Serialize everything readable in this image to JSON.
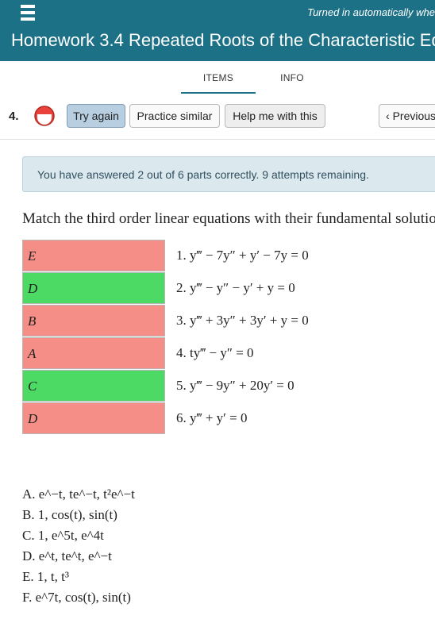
{
  "header": {
    "autosave_text": "Turned in automatically whe",
    "title": "Homework 3.4 Repeated Roots of the Characteristic Eq",
    "brand_color": "#1d7186"
  },
  "tabs": [
    {
      "label": "ITEMS",
      "active": true
    },
    {
      "label": "INFO",
      "active": false
    }
  ],
  "question": {
    "number": "4.",
    "status_icon": "partial-credit-icon",
    "buttons": {
      "try_again": "Try again",
      "practice_similar": "Practice similar",
      "help": "Help me with this",
      "previous": "Previous"
    }
  },
  "alert": {
    "text": "You have answered 2 out of 6 parts correctly. 9 attempts remaining."
  },
  "prompt": "Match the third order linear equations with their fundamental solution",
  "answers": [
    {
      "value": "E",
      "status": "wrong"
    },
    {
      "value": "D",
      "status": "correct"
    },
    {
      "value": "B",
      "status": "wrong"
    },
    {
      "value": "A",
      "status": "wrong"
    },
    {
      "value": "C",
      "status": "correct"
    },
    {
      "value": "D",
      "status": "wrong"
    }
  ],
  "colors": {
    "wrong": "#f48e86",
    "correct": "#4cd964"
  },
  "equations": [
    "1. y‴ − 7y″ + y′ − 7y = 0",
    "2. y‴ − y″ − y′ + y = 0",
    "3. y‴ + 3y″ + 3y′ + y = 0",
    "4. ty‴ − y″ = 0",
    "5. y‴ − 9y″ + 20y′ = 0",
    "6. y‴ + y′ = 0"
  ],
  "solutions": [
    "A. e^−t, te^−t, t²e^−t",
    "B. 1, cos(t), sin(t)",
    "C. 1, e^5t, e^4t",
    "D. e^t, te^t, e^−t",
    "E. 1, t, t³",
    "F. e^7t, cos(t), sin(t)"
  ]
}
